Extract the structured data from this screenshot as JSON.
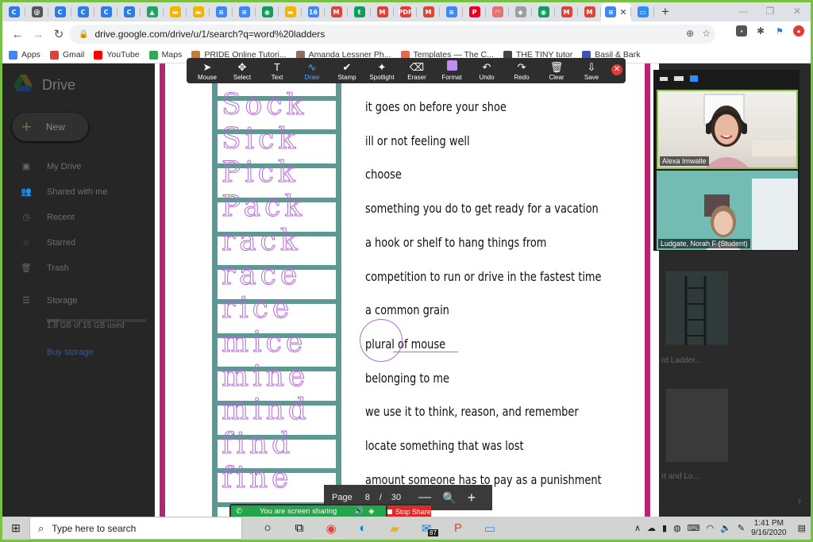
{
  "browser": {
    "tabs": [
      {
        "icon": "C",
        "color": "#2d7be5"
      },
      {
        "icon": "@",
        "color": "#555"
      },
      {
        "icon": "C",
        "color": "#2d7be5"
      },
      {
        "icon": "C",
        "color": "#2d7be5"
      },
      {
        "icon": "C",
        "color": "#2d7be5"
      },
      {
        "icon": "C",
        "color": "#2d7be5"
      },
      {
        "icon": "▲",
        "color": "#1fa463"
      },
      {
        "icon": "▬",
        "color": "#f4b400"
      },
      {
        "icon": "▬",
        "color": "#f4b400"
      },
      {
        "icon": "≡",
        "color": "#4285f4"
      },
      {
        "icon": "≡",
        "color": "#4285f4"
      },
      {
        "icon": "◉",
        "color": "#0f9d58"
      },
      {
        "icon": "▬",
        "color": "#f4b400"
      },
      {
        "icon": "16",
        "color": "#4285f4"
      },
      {
        "icon": "M",
        "color": "#db4437"
      },
      {
        "icon": "t",
        "color": "#0f9d58"
      },
      {
        "icon": "M",
        "color": "#db4437"
      },
      {
        "icon": "PDF",
        "color": "#e53935"
      },
      {
        "icon": "M",
        "color": "#db4437"
      },
      {
        "icon": "≡",
        "color": "#4285f4"
      },
      {
        "icon": "P",
        "color": "#e60023"
      },
      {
        "icon": "◠",
        "color": "#e57373"
      },
      {
        "icon": "◆",
        "color": "#9e9e9e"
      },
      {
        "icon": "◉",
        "color": "#0f9d58"
      },
      {
        "icon": "M",
        "color": "#db4437"
      },
      {
        "icon": "M",
        "color": "#db4437"
      }
    ],
    "active_tab": {
      "icon": "≡",
      "color": "#4285f4"
    },
    "after_tabs": [
      {
        "icon": "▭",
        "color": "#2d8cff"
      }
    ],
    "url": "drive.google.com/drive/u/1/search?q=word%20ladders",
    "bookmarks": [
      {
        "label": "Apps",
        "color": "#4285f4"
      },
      {
        "label": "Gmail",
        "color": "#db4437"
      },
      {
        "label": "YouTube",
        "color": "#ff0000"
      },
      {
        "label": "Maps",
        "color": "#34a853"
      },
      {
        "label": "PRIDE Online Tutori...",
        "color": "#c0803a"
      },
      {
        "label": "Amanda Lessner Ph...",
        "color": "#8d6e63"
      },
      {
        "label": "Templates — The C...",
        "color": "#e86a4a"
      },
      {
        "label": "THE TINY tutor",
        "color": "#444"
      },
      {
        "label": "Basil & Bark",
        "color": "#3f51b5"
      }
    ]
  },
  "drive": {
    "title": "Drive",
    "new_label": "New",
    "nav": [
      {
        "label": "My Drive",
        "icon": "▣"
      },
      {
        "label": "Shared with me",
        "icon": "👥"
      },
      {
        "label": "Recent",
        "icon": "◷"
      },
      {
        "label": "Starred",
        "icon": "☆"
      },
      {
        "label": "Trash",
        "icon": "🗑"
      }
    ],
    "storage_label": "Storage",
    "storage_text": "1.8 GB of 15 GB used",
    "storage_fraction": 0.12,
    "buy_label": "Buy storage",
    "right_captions": [
      "rd Ladder...",
      "rt and Lo..."
    ]
  },
  "annotate": {
    "tools": [
      {
        "label": "Mouse",
        "icon": "➤"
      },
      {
        "label": "Select",
        "icon": "✥"
      },
      {
        "label": "Text",
        "icon": "T"
      },
      {
        "label": "Draw",
        "icon": "∿",
        "active": true
      },
      {
        "label": "Stamp",
        "icon": "✔"
      },
      {
        "label": "Spotlight",
        "icon": "✦"
      },
      {
        "label": "Eraser",
        "icon": "⌫"
      },
      {
        "label": "Format",
        "icon": ""
      },
      {
        "label": "Undo",
        "icon": "↶"
      },
      {
        "label": "Redo",
        "icon": "↷"
      },
      {
        "label": "Clear",
        "icon": "🗑"
      },
      {
        "label": "Save",
        "icon": "⇩"
      }
    ],
    "format_color": "#c28cf5",
    "close_icon": "✕"
  },
  "worksheet": {
    "ladder_words": [
      "Sock",
      "Sick",
      "Pick",
      "Pack",
      "rack",
      "race",
      "rice",
      "mice",
      "mine",
      "mind",
      "find",
      "fine"
    ],
    "clues": [
      "it goes on before your shoe",
      "ill or not feeling well",
      "choose",
      "something you do to get ready for a vacation",
      "a hook or shelf to hang things from",
      "competition to run or drive in the fastest time",
      "a common grain",
      "plural of mouse",
      "belonging to me",
      "we use it to think, reason, and remember",
      "locate something that was lost",
      "amount someone has to pay as a punishment"
    ]
  },
  "zoom": {
    "participants": [
      {
        "name": "Alexa Imwalle"
      },
      {
        "name": "Ludgate, Norah F (Student)"
      }
    ],
    "page_label": "Page",
    "page_current": "8",
    "page_sep": "/",
    "page_total": "30",
    "sharing_text": "You are screen sharing",
    "stop_share": "Stop Share"
  },
  "taskbar": {
    "search_placeholder": "Type here to search",
    "mail_badge": "87",
    "time": "1:41 PM",
    "date": "9/16/2020"
  }
}
